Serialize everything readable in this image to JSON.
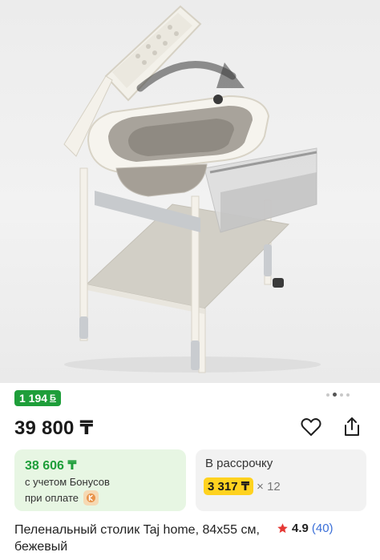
{
  "product": {
    "bonus_badge": "1 194",
    "bonus_badge_coin": "Б",
    "gallery_pages": 4,
    "gallery_active_page": 2,
    "price": "39 800 ₸",
    "bonus_card": {
      "price": "38 606 ₸",
      "line1": "с учетом Бонусов",
      "line2": "при оплате"
    },
    "installment_card": {
      "title": "В рассрочку",
      "amount": "3 317 ₸",
      "multiplier": "× 12"
    },
    "title": "Пеленальный столик Taj home, 84x55 см, бежевый",
    "rating": {
      "score": "4.9",
      "count": "(40)"
    }
  },
  "icons": {
    "favorite": "heart-icon",
    "share": "share-icon",
    "rating": "star-icon",
    "payment": "kaspi-pay-icon"
  },
  "colors": {
    "bonus_green": "#1e9e3a",
    "bonus_card_bg": "#e7f6e3",
    "installment_highlight": "#ffd21f",
    "rating_star": "#e53935",
    "rating_count": "#3a6fd8"
  }
}
